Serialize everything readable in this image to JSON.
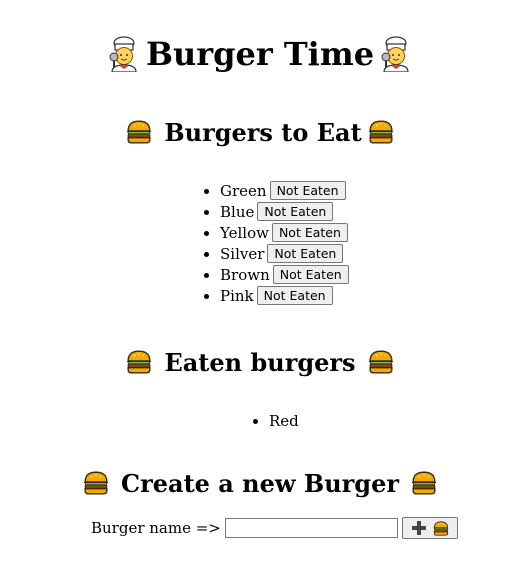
{
  "title": "Burger Time",
  "sections": {
    "todo_title": "Burgers to Eat",
    "eaten_title": "Eaten burgers",
    "create_title": "Create a new Burger"
  },
  "todo_burgers": [
    {
      "name": "Green",
      "button": "Not Eaten"
    },
    {
      "name": "Blue",
      "button": "Not Eaten"
    },
    {
      "name": "Yellow",
      "button": "Not Eaten"
    },
    {
      "name": "Silver",
      "button": "Not Eaten"
    },
    {
      "name": "Brown",
      "button": "Not Eaten"
    },
    {
      "name": "Pink",
      "button": "Not Eaten"
    }
  ],
  "eaten_burgers": [
    {
      "name": "Red"
    }
  ],
  "form": {
    "label": "Burger name =>",
    "value": "",
    "placeholder": ""
  },
  "icons": {
    "title": "chef-icon",
    "section": "burger-icon",
    "add_button": [
      "plus-icon",
      "burger-icon"
    ]
  }
}
